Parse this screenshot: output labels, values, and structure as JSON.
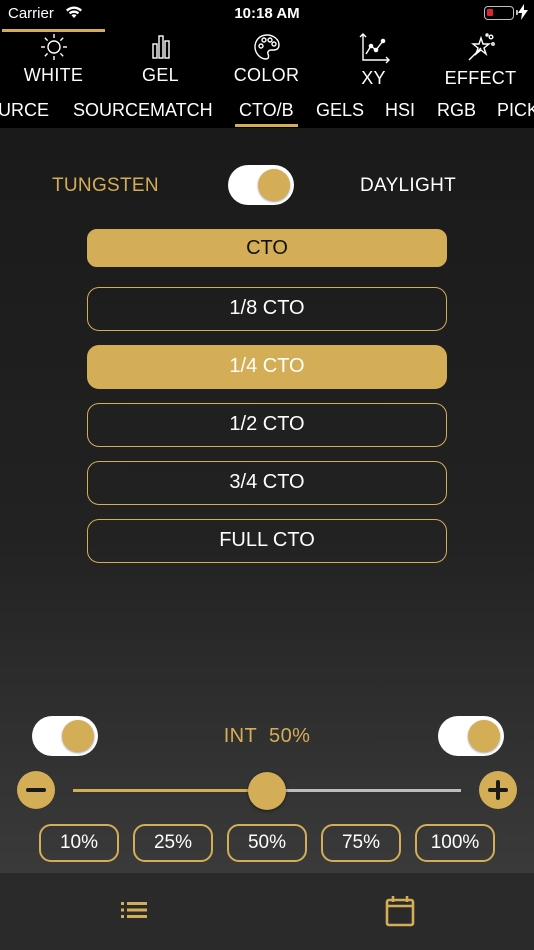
{
  "status_bar": {
    "carrier": "Carrier",
    "time": "10:18 AM",
    "battery_color": "#e0242f"
  },
  "mode_tabs": [
    {
      "label": "WHITE",
      "icon": "sun-icon",
      "active": true
    },
    {
      "label": "GEL",
      "icon": "bar-chart-icon",
      "active": false
    },
    {
      "label": "COLOR",
      "icon": "palette-icon",
      "active": false
    },
    {
      "label": "XY",
      "icon": "xy-graph-icon",
      "active": false
    },
    {
      "label": "EFFECT",
      "icon": "magic-wand-icon",
      "active": false
    }
  ],
  "sub_tabs": [
    {
      "label": "URCE",
      "active": false
    },
    {
      "label": "SOURCEMATCH",
      "active": false
    },
    {
      "label": "CTO/B",
      "active": true
    },
    {
      "label": "GELS",
      "active": false
    },
    {
      "label": "HSI",
      "active": false
    },
    {
      "label": "RGB",
      "active": false
    },
    {
      "label": "PICK",
      "active": false
    }
  ],
  "cto": {
    "tungsten_label": "TUNGSTEN",
    "daylight_label": "DAYLIGHT",
    "toggle_on": true,
    "header": "CTO",
    "options": [
      "1/8 CTO",
      "1/4 CTO",
      "1/2 CTO",
      "3/4 CTO",
      "FULL CTO"
    ],
    "selected": "1/4 CTO"
  },
  "intensity": {
    "label": "INT",
    "value_text": "50%",
    "value": 0.5,
    "left_toggle_on": true,
    "right_toggle_on": true,
    "presets": [
      "10%",
      "25%",
      "50%",
      "75%",
      "100%"
    ]
  },
  "bottom_bar": {
    "left_icon": "list-icon",
    "right_icon": "calendar-icon"
  },
  "colors": {
    "accent": "#d4ad57",
    "background": "#000000"
  }
}
